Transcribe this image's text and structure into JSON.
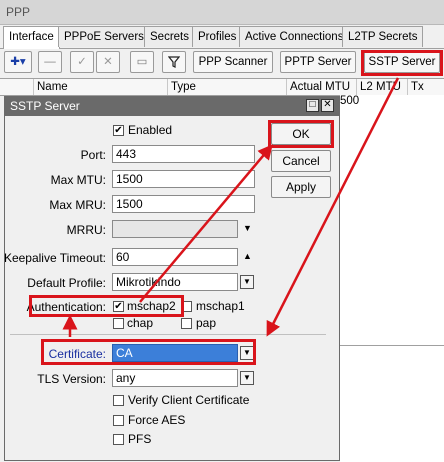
{
  "window": {
    "title": "PPP"
  },
  "tabs": [
    "Interface",
    "PPPoE Servers",
    "Secrets",
    "Profiles",
    "Active Connections",
    "L2TP Secrets"
  ],
  "toolbar": {
    "ppp_scanner": "PPP Scanner",
    "pptp_server": "PPTP Server",
    "sstp_server": "SSTP Server"
  },
  "grid": {
    "columns": [
      "Name",
      "Type",
      "Actual MTU",
      "L2 MTU",
      "Tx"
    ],
    "mtu_value": "500"
  },
  "dialog": {
    "title": "SSTP Server",
    "enabled_label": "Enabled",
    "enabled": true,
    "port_label": "Port:",
    "port": "443",
    "max_mtu_label": "Max MTU:",
    "max_mtu": "1500",
    "max_mru_label": "Max MRU:",
    "max_mru": "1500",
    "mrru_label": "MRRU:",
    "mrru": "",
    "keepalive_label": "Keepalive Timeout:",
    "keepalive": "60",
    "default_profile_label": "Default Profile:",
    "default_profile": "MikrotikIndo",
    "authentication_label": "Authentication:",
    "auth": {
      "mschap2": "mschap2",
      "mschap1": "mschap1",
      "chap": "chap",
      "pap": "pap"
    },
    "certificate_label": "Certificate:",
    "certificate": "CA",
    "tls_label": "TLS Version:",
    "tls": "any",
    "verify_client": "Verify Client Certificate",
    "force_aes": "Force AES",
    "pfs": "PFS",
    "buttons": {
      "ok": "OK",
      "cancel": "Cancel",
      "apply": "Apply"
    }
  }
}
